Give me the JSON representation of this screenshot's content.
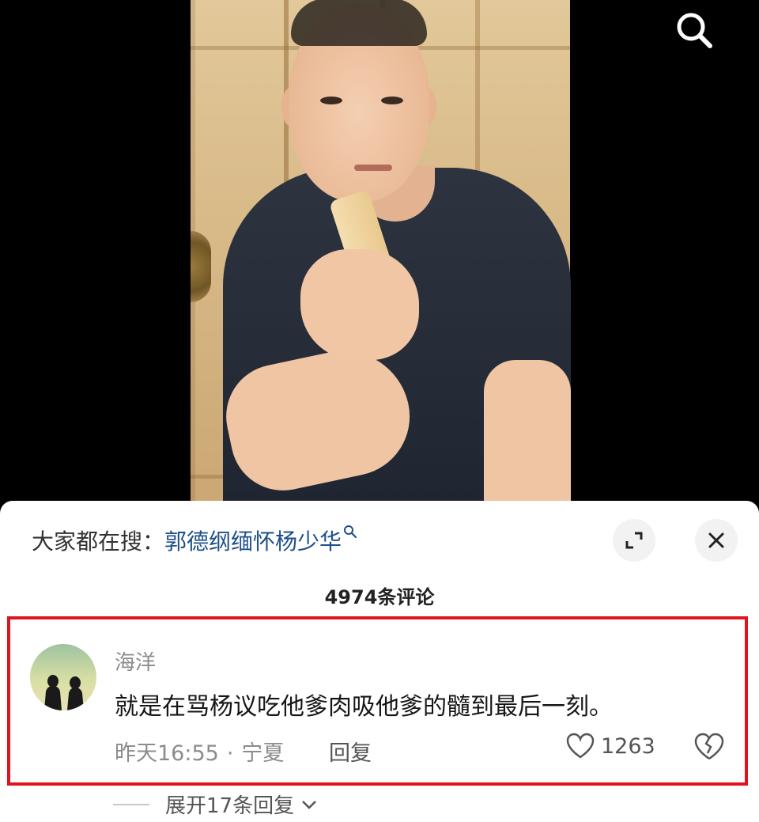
{
  "video": {
    "search_icon": "search-icon"
  },
  "comments_panel": {
    "trending_label": "大家都在搜：",
    "trending_term": "郭德纲缅怀杨少华",
    "trending_icon": "search-icon",
    "expand_icon": "expand-icon",
    "close_icon": "close-icon",
    "comment_count": "4974条评论"
  },
  "comment": {
    "username": "海洋",
    "text": "就是在骂杨议吃他爹肉吸他爹的髓到最后一刻。",
    "time": "昨天16:55",
    "separator": "·",
    "location": "宁夏",
    "reply_label": "回复",
    "like_count": "1263",
    "like_icon": "heart-icon",
    "dislike_icon": "broken-heart-icon",
    "highlight_color": "#e0141e"
  },
  "replies": {
    "expand_label": "展开17条回复",
    "chevron_icon": "chevron-down-icon"
  }
}
